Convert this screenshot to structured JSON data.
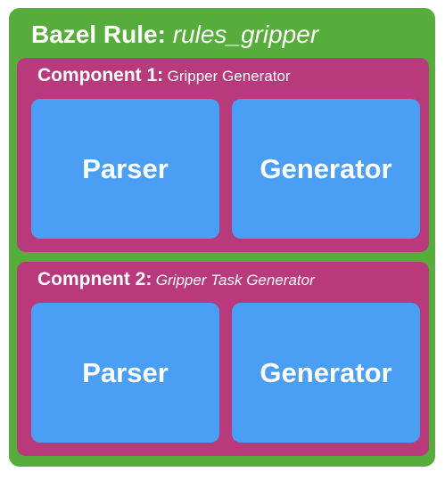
{
  "rule": {
    "label": "Bazel Rule:",
    "name": "rules_gripper"
  },
  "components": [
    {
      "label": "Component 1:",
      "name": "Gripper Generator",
      "parts": [
        "Parser",
        "Generator"
      ]
    },
    {
      "label": "Compnent 2:",
      "name": "Gripper Task Generator",
      "parts": [
        "Parser",
        "Generator"
      ]
    }
  ],
  "colors": {
    "rule_bg": "#56ad3b",
    "component_bg": "#b9397d",
    "part_bg": "#4a9ff5",
    "text": "#ffffff"
  }
}
